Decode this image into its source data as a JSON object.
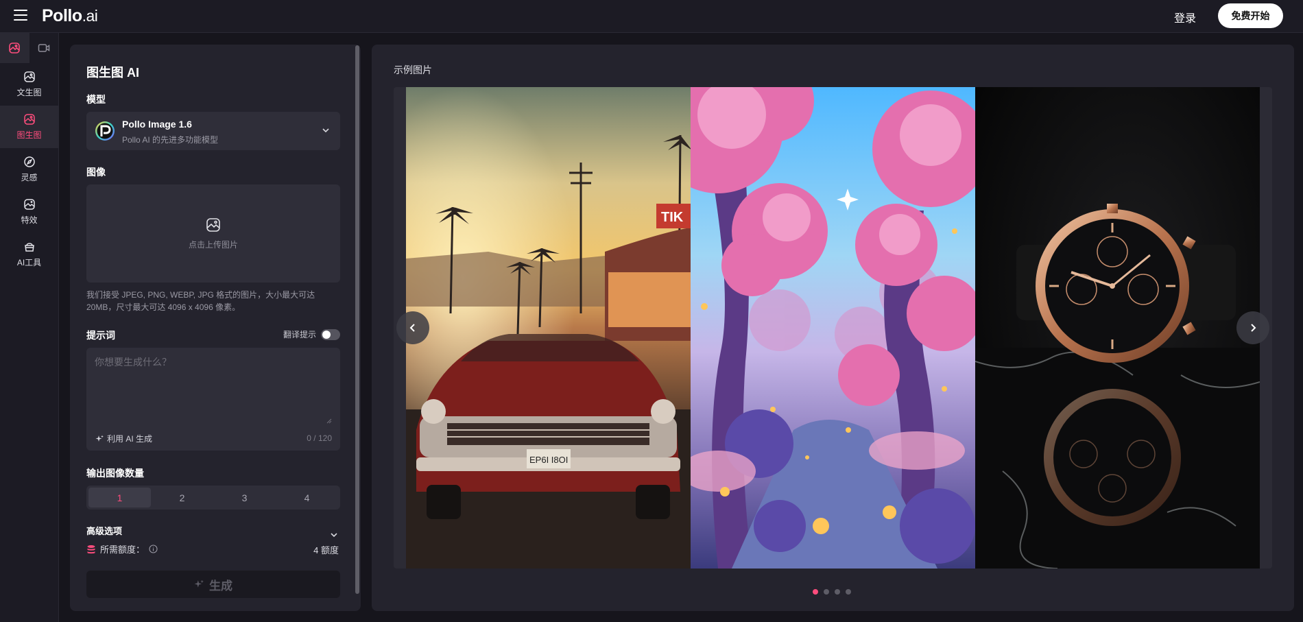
{
  "header": {
    "logo_main": "Pollo",
    "logo_suffix": ".ai",
    "login_label": "登录",
    "start_label": "免费开始"
  },
  "sidebar": {
    "items": [
      {
        "label": "文生图",
        "icon": "text-to-image-icon"
      },
      {
        "label": "图生图",
        "icon": "image-to-image-icon",
        "active": true
      },
      {
        "label": "灵感",
        "icon": "compass-icon"
      },
      {
        "label": "特效",
        "icon": "effects-icon"
      },
      {
        "label": "AI工具",
        "icon": "ai-tools-icon"
      }
    ]
  },
  "panel": {
    "title": "图生图 AI",
    "model_label": "模型",
    "model_name": "Pollo Image 1.6",
    "model_desc": "Pollo AI 的先进多功能模型",
    "image_label": "图像",
    "upload_text": "点击上传图片",
    "upload_hint": "我们接受 JPEG, PNG, WEBP, JPG 格式的图片，大小最大可达 20MB，尺寸最大可达 4096 x 4096 像素。",
    "prompt_label": "提示词",
    "translate_label": "翻译提示",
    "prompt_placeholder": "你想要生成什么？",
    "ai_generate_label": "利用 AI 生成",
    "char_counter": "0 / 120",
    "count_label": "输出图像数量",
    "count_options": [
      "1",
      "2",
      "3",
      "4"
    ],
    "count_selected": "1",
    "advanced_label": "高级选项",
    "credits_label": "所需额度：",
    "credits_value": "4 额度",
    "generate_label": "生成"
  },
  "example": {
    "title": "示例图片",
    "slides": [
      "classic-red-convertible-car",
      "pink-fantasy-forest",
      "rose-gold-chronograph-watch"
    ],
    "slide_sign_text": "TIK",
    "plate_text": "EP6I I8OI",
    "dot_count": 4,
    "active_dot": 1
  },
  "colors": {
    "accent": "#ff4d7d",
    "background": "#16151c",
    "panel": "#24232d",
    "input": "#2f2e39"
  }
}
